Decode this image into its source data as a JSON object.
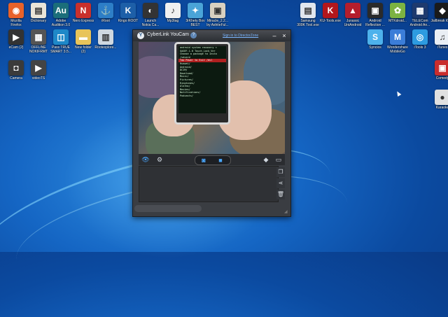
{
  "window": {
    "title": "CyberLink YouCam",
    "help_label": "?",
    "signin_label": "Sign in to DirectorZone",
    "minimize_label": "–",
    "close_label": "×"
  },
  "phone_screen_lines": [
    "android system recovery <",
    "GAGEF-1.0 Touch_Lock_Ver",
    "",
    "Choose a package to insta",
    "/sdcard",
    "",
    "Tap Power to Exit /dsl",
    "Huawei/",
    "Android/",
    "DCIM/",
    "Download/",
    "Music/",
    "Pictures/",
    "Ringtones/",
    "Alarms/",
    "Movies/",
    "Notifications/",
    "Podcasts/"
  ],
  "desktop_icons_left": [
    {
      "label": "Mozilla\nFirefox",
      "color": "#e8622a",
      "glyph": "◉"
    },
    {
      "label": "Dictionary",
      "color": "#e9e4d8",
      "glyph": "▤"
    },
    {
      "label": "Adobe\nAudition 3.0",
      "color": "#1b6e7a",
      "glyph": "Au"
    },
    {
      "label": "Nero Express",
      "color": "#c9302c",
      "glyph": "N"
    },
    {
      "label": "iRoot",
      "color": "#2d7ec7",
      "glyph": "⚓"
    },
    {
      "label": "Kingo ROOT",
      "color": "#1d5fa8",
      "glyph": "K"
    },
    {
      "label": "Launch\nNokia Ca...",
      "color": "#333",
      "glyph": "◐"
    },
    {
      "label": "Mp3tag",
      "color": "#f0f0f0",
      "glyph": "♪"
    },
    {
      "label": "3rKhety Bov\nBEST",
      "color": "#4aa4d8",
      "glyph": "✦"
    },
    {
      "label": "Miracle_2.2...\nby AshiteFul...",
      "color": "#d8d0c0",
      "glyph": "▣"
    },
    {
      "label": "eCam (2)",
      "color": "#333",
      "glyph": "▶"
    },
    {
      "label": "OFFLINE\nNOKIFRMT",
      "color": "#555",
      "glyph": "▦"
    },
    {
      "label": "Pass TRUE\nSMART 3.5...",
      "color": "#1e88c8",
      "glyph": "◫"
    },
    {
      "label": "New folder\n(2)",
      "color": "#e8c45a",
      "glyph": "▬"
    },
    {
      "label": "Rootexplore...",
      "color": "#cfd8e0",
      "glyph": "▥"
    },
    {
      "label": "Camera",
      "color": "#3b3b3b",
      "glyph": "◘"
    },
    {
      "label": "videoTS",
      "color": "#444",
      "glyph": "▶"
    }
  ],
  "desktop_icons_right": [
    {
      "label": "Samsung\n300K Tool.exe",
      "color": "#e0e6ee",
      "glyph": "▤"
    },
    {
      "label": "KU-Tools.exe",
      "color": "#b3171c",
      "glyph": "K"
    },
    {
      "label": "Jurassic\nUniAndroid",
      "color": "#b41e2d",
      "glyph": "▲"
    },
    {
      "label": "Android\nReflection ...",
      "color": "#2a2a2a",
      "glyph": "▣"
    },
    {
      "label": "MTKdroid...",
      "color": "#7cb342",
      "glyph": "✿"
    },
    {
      "label": "TELECom\nAndroid An...",
      "color": "#1e3a6e",
      "glyph": "▦"
    },
    {
      "label": "Jailbreak iOs...",
      "color": "#1a1a1a",
      "glyph": "◆"
    },
    {
      "label": "Syncios",
      "color": "#4db2ec",
      "glyph": "S"
    },
    {
      "label": "Wondershare\nMobileGo",
      "color": "#3b7dd8",
      "glyph": "M"
    },
    {
      "label": "iTools 3",
      "color": "#2d9be0",
      "glyph": "◎"
    },
    {
      "label": "iTunes",
      "color": "#e9eef4",
      "glyph": "♫"
    },
    {
      "label": "Comedy",
      "color": "#c92d2d",
      "glyph": "▣"
    },
    {
      "label": "Karaoke",
      "color": "#e0e0e0",
      "glyph": "●"
    }
  ]
}
